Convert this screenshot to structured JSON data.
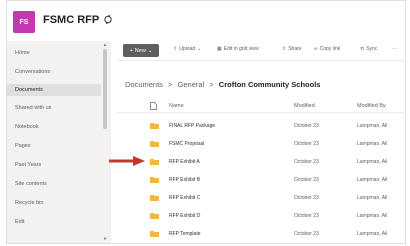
{
  "site": {
    "logo_text": "FS",
    "title": "FSMC RFP",
    "brand_color": "#c239b3"
  },
  "sidebar": {
    "items": [
      {
        "label": "Home"
      },
      {
        "label": "Conversations"
      },
      {
        "label": "Documents",
        "active": true
      },
      {
        "label": "Shared with us"
      },
      {
        "label": "Notebook"
      },
      {
        "label": "Pages"
      },
      {
        "label": "Past Years"
      },
      {
        "label": "Site contents"
      },
      {
        "label": "Recycle bin"
      },
      {
        "label": "Edit"
      }
    ]
  },
  "toolbar": {
    "new_label": "New",
    "upload_label": "Upload",
    "edit_grid_label": "Edit in grid view",
    "share_label": "Share",
    "copy_link_label": "Copy link",
    "sync_label": "Sync",
    "more_label": "···"
  },
  "breadcrumb": {
    "items": [
      "Documents",
      "General"
    ],
    "current": "Crofton Community Schools",
    "separator": ">"
  },
  "table": {
    "headers": {
      "name": "Name",
      "modified": "Modified",
      "modified_by": "Modified By"
    },
    "rows": [
      {
        "name": "FINAL RFP Package",
        "modified": "October 23",
        "modified_by": "Lampman, Ali"
      },
      {
        "name": "FSMC Proposal",
        "modified": "October 23",
        "modified_by": "Lampman, Ali"
      },
      {
        "name": "RFP Exhibit A",
        "modified": "October 23",
        "modified_by": "Lampman, Ali"
      },
      {
        "name": "RFP Exhibit B",
        "modified": "October 23",
        "modified_by": "Lampman, Ali"
      },
      {
        "name": "RFP Exhibit C",
        "modified": "October 23",
        "modified_by": "Lampman, Ali"
      },
      {
        "name": "RFP Exhibit D",
        "modified": "October 23",
        "modified_by": "Lampman, Ali"
      },
      {
        "name": "RFP Template",
        "modified": "October 23",
        "modified_by": "Lampman, Ali"
      }
    ]
  },
  "colors": {
    "folder": "#f5b83d",
    "arrow": "#c0392b",
    "new_button": "#605e5c"
  },
  "icons": [
    "site-logo",
    "sync-icon",
    "document-icon",
    "folder-icon",
    "arrow-pointer-icon"
  ]
}
